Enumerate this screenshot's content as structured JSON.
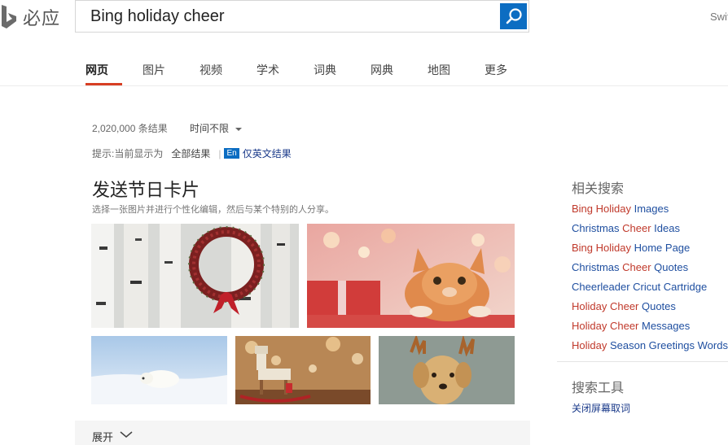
{
  "brand": {
    "logo_text": "必应"
  },
  "search": {
    "query": "Bing holiday cheer"
  },
  "header": {
    "switch_label": "Swit"
  },
  "tabs": [
    {
      "label": "网页"
    },
    {
      "label": "图片"
    },
    {
      "label": "视频"
    },
    {
      "label": "学术"
    },
    {
      "label": "词典"
    },
    {
      "label": "网典"
    },
    {
      "label": "地图"
    },
    {
      "label": "更多"
    }
  ],
  "results": {
    "count": "2,020,000 条结果",
    "time_filter": "时间不限",
    "hint_prefix": "提示:当前显示为",
    "hint_all": "全部结果",
    "hint_sep": "|",
    "en_badge": "En",
    "en_only": "仅英文结果"
  },
  "card": {
    "title": "发送节日卡片",
    "subtitle": "选择一张图片并进行个性化编辑，然后与某个特别的人分享。",
    "images": [
      {
        "icon": "wreath-birch-image"
      },
      {
        "icon": "cat-gift-image"
      },
      {
        "icon": "polar-bear-snow-image"
      },
      {
        "icon": "rocking-horse-image"
      },
      {
        "icon": "dog-antlers-image"
      }
    ],
    "expand_label": "展开"
  },
  "sidebar": {
    "related_title": "相关搜索",
    "related": [
      [
        {
          "t": "Bing Holiday",
          "h": true
        },
        {
          "t": " Images",
          "h": false
        }
      ],
      [
        {
          "t": "Christmas ",
          "h": false
        },
        {
          "t": "Cheer",
          "h": true
        },
        {
          "t": " Ideas",
          "h": false
        }
      ],
      [
        {
          "t": "Bing Holiday",
          "h": true
        },
        {
          "t": " Home Page",
          "h": false
        }
      ],
      [
        {
          "t": "Christmas ",
          "h": false
        },
        {
          "t": "Cheer",
          "h": true
        },
        {
          "t": " Quotes",
          "h": false
        }
      ],
      [
        {
          "t": "Cheerleader Cricut Cartridge",
          "h": false
        }
      ],
      [
        {
          "t": "Holiday Cheer",
          "h": true
        },
        {
          "t": " Quotes",
          "h": false
        }
      ],
      [
        {
          "t": "Holiday Cheer",
          "h": true
        },
        {
          "t": " Messages",
          "h": false
        }
      ],
      [
        {
          "t": "Holiday",
          "h": true
        },
        {
          "t": " Season Greetings Words",
          "h": false
        }
      ]
    ],
    "tools_title": "搜索工具",
    "tools_link": "关闭屏幕取词"
  },
  "colors": {
    "accent": "#0c6dc2",
    "tab_active": "#d73f23",
    "highlight": "#c0392b",
    "link": "#1f4fa0"
  }
}
